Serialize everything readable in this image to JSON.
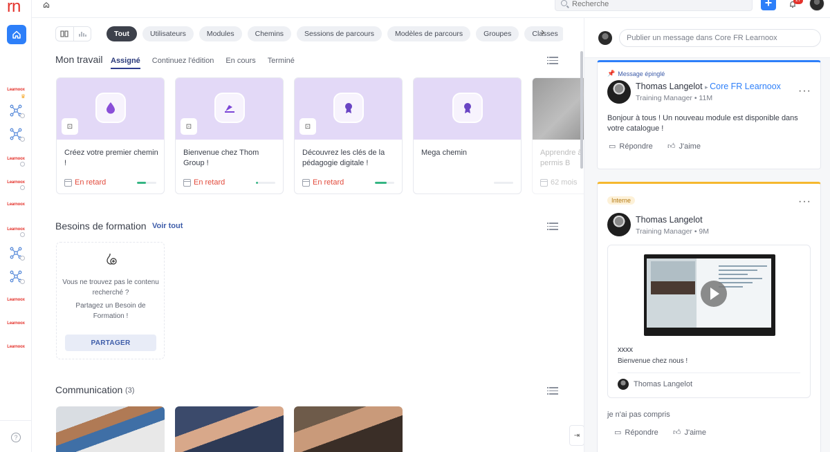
{
  "app": {
    "logo": "rn"
  },
  "rail": {
    "items": [
      {
        "name": "learnoox-org-1",
        "label": "Learnoox"
      },
      {
        "name": "learnoox-org-2",
        "label": "Learnoox"
      },
      {
        "name": "learnoox-org-3",
        "label": "Learnoox"
      },
      {
        "name": "learnoox-org-4",
        "label": "Learnoox"
      },
      {
        "name": "learnoox-org-5",
        "label": "Learnoox"
      },
      {
        "name": "learnoox-org-6",
        "label": "Learnoox"
      },
      {
        "name": "learnoox-org-7",
        "label": "Learnoox"
      },
      {
        "name": "learnoox-org-8",
        "label": "Learnoox"
      }
    ],
    "help": "?"
  },
  "topbar": {
    "search_placeholder": "Recherche",
    "plus": "+",
    "notifications": "27"
  },
  "filters": {
    "chips": [
      "Tout",
      "Utilisateurs",
      "Modules",
      "Chemins",
      "Sessions de parcours",
      "Modèles de parcours",
      "Groupes",
      "Classes"
    ]
  },
  "work": {
    "title": "Mon travail",
    "tabs": [
      "Assigné",
      "Continuez l'édition",
      "En cours",
      "Terminé"
    ],
    "cards": [
      {
        "title": "Créez votre premier chemin !",
        "status": "En retard",
        "progress": 0.45
      },
      {
        "title": "Bienvenue chez Thom Group !",
        "status": "En retard",
        "progress": 0.1
      },
      {
        "title": "Découvrez les clés de la pédagogie digitale !",
        "status": "En retard",
        "progress": 0.6
      },
      {
        "title": "Mega chemin",
        "status": "",
        "progress": 0
      },
      {
        "title": "Apprendre à conduire - permis B",
        "status": "62 mois",
        "progress": 0
      }
    ]
  },
  "needs": {
    "title": "Besoins de formation",
    "view_all": "Voir tout",
    "line1": "Vous ne trouvez pas le contenu recherché ?",
    "line2": "Partagez un Besoin de Formation !",
    "button": "PARTAGER"
  },
  "communication": {
    "title": "Communication",
    "count": "(3)"
  },
  "feed": {
    "composer_placeholder": "Publier un message dans Core FR Learnoox",
    "pinned": {
      "label": "Message épinglé",
      "author": "Thomas Langelot",
      "group": "Core FR Learnoox",
      "role": "Training Manager",
      "time": "11M",
      "body": "Bonjour à tous ! Un nouveau module est disponible dans votre catalogue !",
      "reply": "Répondre",
      "like": "J'aime"
    },
    "internal": {
      "tag": "Interne",
      "author": "Thomas Langelot",
      "role": "Training Manager",
      "time": "9M",
      "embed_title": "xxxx",
      "embed_subtitle": "Bienvenue chez nous !",
      "embed_author": "Thomas Langelot",
      "comment": "je n'ai pas compris",
      "reply": "Répondre",
      "like": "J'aime"
    }
  },
  "colors": {
    "accent": "#2d7ff9",
    "late": "#e24a3b",
    "card_bg": "#e3d9f7",
    "progress": "#34b583"
  }
}
